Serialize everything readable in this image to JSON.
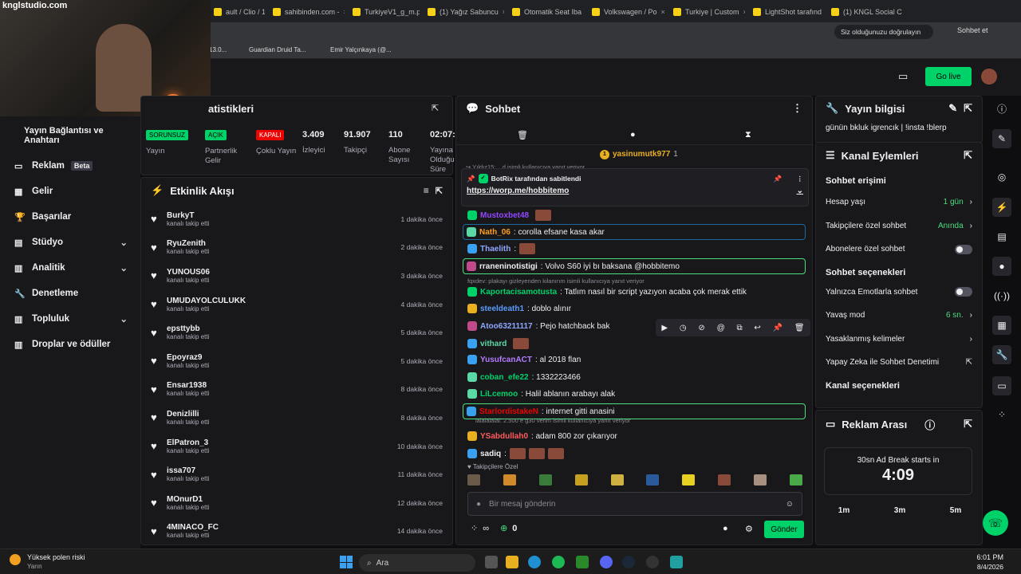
{
  "browser": {
    "tabs": [
      "ault / Clio / 1.",
      "sahibinden.com -",
      "TurkiyeV1_g_m.p",
      "(1) Yağız Sabuncu",
      "Otomatik Seat Iba",
      "Volkswagen / Po",
      "Turkiye | Custom",
      "LightShot tarafınd",
      "(1) KNGL Social C"
    ],
    "verify_label": "Siz olduğunuzu doğrulayın",
    "chat_label": "Sohbet et",
    "bookmarks": [
      "13.0...",
      "Guardian Druid Ta...",
      "Emir Yalçınkaya (@..."
    ]
  },
  "overlay": {
    "watermark": "knglstudio.com"
  },
  "header": {
    "go_live": "Go live"
  },
  "stats": {
    "title": "atistikleri",
    "items": [
      {
        "badge": "SORUNSUZ",
        "badge_color": "#00d26a",
        "label": "Yayın"
      },
      {
        "badge": "AÇIK",
        "badge_color": "#00d26a",
        "label": "Partnerlik Gelir"
      },
      {
        "badge": "KAPALI",
        "badge_color": "#eb0400",
        "label": "Çoklu Yayın"
      },
      {
        "value": "3.409",
        "label": "İzleyici"
      },
      {
        "value": "91.907",
        "label": "Takipçi"
      },
      {
        "value": "110",
        "label": "Abone Sayısı"
      },
      {
        "value": "02:07:",
        "label": "Yayına Olduğu Süre"
      }
    ]
  },
  "sidebar": {
    "top_label": "Yayın Bağlantısı ve Anahtarı",
    "items": [
      {
        "label": "Reklam",
        "badge": "Beta",
        "icon": "ad-icon"
      },
      {
        "label": "Gelir",
        "icon": "revenue-icon"
      },
      {
        "label": "Başarılar",
        "icon": "trophy-icon"
      },
      {
        "label": "Stüdyo",
        "icon": "studio-icon",
        "chev": "⌄"
      },
      {
        "label": "Analitik",
        "icon": "analytics-icon",
        "chev": "⌄"
      },
      {
        "label": "Denetleme",
        "icon": "moderation-icon"
      },
      {
        "label": "Topluluk",
        "icon": "community-icon",
        "chev": "⌄"
      },
      {
        "label": "Droplar ve ödüller",
        "icon": "drops-icon"
      }
    ]
  },
  "activity": {
    "title": "Etkinlik Akışı",
    "events": [
      {
        "name": "BurkyT",
        "sub": "kanalı takip etti",
        "time": "1 dakika önce"
      },
      {
        "name": "RyuZenith",
        "sub": "kanalı takip etti",
        "time": "2 dakika önce"
      },
      {
        "name": "YUNOUS06",
        "sub": "kanalı takip etti",
        "time": "3 dakika önce"
      },
      {
        "name": "UMUDAYOLCULUKK",
        "sub": "kanalı takip etti",
        "time": "4 dakika önce"
      },
      {
        "name": "epsttybb",
        "sub": "kanalı takip etti",
        "time": "5 dakika önce"
      },
      {
        "name": "Epoyraz9",
        "sub": "kanalı takip etti",
        "time": "5 dakika önce"
      },
      {
        "name": "Ensar1938",
        "sub": "kanalı takip etti",
        "time": "8 dakika önce"
      },
      {
        "name": "Denizlilli",
        "sub": "kanalı takip etti",
        "time": "8 dakika önce"
      },
      {
        "name": "ElPatron_3",
        "sub": "kanalı takip etti",
        "time": "10 dakika önce"
      },
      {
        "name": "issa707",
        "sub": "kanalı takip etti",
        "time": "11 dakika önce"
      },
      {
        "name": "MOnurD1",
        "sub": "kanalı takip etti",
        "time": "12 dakika önce"
      },
      {
        "name": "4MINACO_FC",
        "sub": "kanalı takip etti",
        "time": "14 dakika önce"
      }
    ]
  },
  "chat": {
    "title": "Sohbet",
    "top_gifter": "yasinumutk977",
    "top_gifter_count": "1",
    "pinned_by": "BotRix tarafından sabitlendi",
    "pinned_link": "https://worp.me/hobbitemo",
    "reply1": "fqxdev: plakayı gizleyenden kilanırım isimli kullanıcıya yanıt veriyor",
    "reply2": "lalalalalal: 2.500 e g30 verim isimli kullanıcıya yanıt veriyor",
    "messages": [
      {
        "user": "Mustoxbet48",
        "color": "#9146ff",
        "text": ""
      },
      {
        "user": "Nath_06",
        "color": "#ff9f1a",
        "text": ": corolla efsane kasa akar"
      },
      {
        "user": "Thaelith",
        "color": "#8fa6ff",
        "text": ":"
      },
      {
        "user": "rraneninotistigi",
        "color": "#efeff1",
        "text": ": Volvo S60 iyi bı baksana @hobbitemo"
      },
      {
        "user": "Kaportacisamotusta",
        "color": "#00d26a",
        "text": ": Tatlım nasıl bir script yazıyon acaba çok merak ettik"
      },
      {
        "user": "steeldeath1",
        "color": "#5b9cff",
        "text": ": doblo alınır"
      },
      {
        "user": "Atoo63211117",
        "color": "#8fa6ff",
        "text": ": Pejo hatchback bak"
      },
      {
        "user": "vithard",
        "color": "#5ad8a6",
        "text": ""
      },
      {
        "user": "YusufcanACT",
        "color": "#b67cff",
        "text": ": al 2018 flan"
      },
      {
        "user": "coban_efe22",
        "color": "#00d26a",
        "text": ": 1332223466"
      },
      {
        "user": "LiLcemoo",
        "color": "#00d26a",
        "text": ": Halil ablanın arabayı alak"
      },
      {
        "user": "StarlordistakeN",
        "color": "#eb0400",
        "text": ": internet gitti anasini"
      },
      {
        "user": "YSabdullah0",
        "color": "#ff5b5b",
        "text": ": adam 800 zor çıkarıyor"
      },
      {
        "user": "sadiq",
        "color": "#efeff1",
        "text": ":"
      }
    ],
    "followers_only": "Takipçilere Özel",
    "input_placeholder": "Bir mesaj gönderin",
    "points": "0",
    "send": "Gönder"
  },
  "right": {
    "info_title": "Yayın bilgisi",
    "stream_title": "günün bkluk igrencık | !insta !blerp",
    "actions_title": "Kanal Eylemleri",
    "chat_access": "Sohbet erişimi",
    "access": [
      {
        "label": "Hesap yaşı",
        "value": "1 gün"
      },
      {
        "label": "Takipçilere özel sohbet",
        "value": "Anında"
      },
      {
        "label": "Abonelere özel sohbet",
        "toggle": true
      }
    ],
    "chat_options": "Sohbet seçenekleri",
    "options": [
      {
        "label": "Yalnızca Emotlarla sohbet",
        "toggle": true
      },
      {
        "label": "Yavaş mod",
        "value": "6 sn."
      },
      {
        "label": "Yasaklanmış kelimeler",
        "value": ""
      },
      {
        "label": "Yapay Zeka ile Sohbet Denetimi",
        "value": ""
      }
    ],
    "channel_options": "Kanal seçenekleri",
    "ad_title": "Reklam Arası",
    "ad_caption": "30sn Ad Break starts in",
    "ad_timer": "4:09",
    "ad_buttons": [
      "1m",
      "3m",
      "5m"
    ]
  },
  "taskbar": {
    "weather": "Yüksek polen riski",
    "weather_sub": "Yarın",
    "search": "Ara",
    "time": "6:01 PM",
    "date": "8/4/2026"
  }
}
